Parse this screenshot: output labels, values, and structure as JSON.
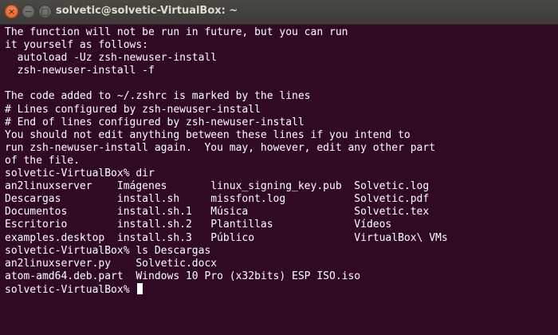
{
  "window": {
    "title": "solvetic@solvetic-VirtualBox: ~",
    "controls": {
      "close": "×",
      "minimize": "−",
      "maximize": "□"
    }
  },
  "colors": {
    "terminal_background": "#300a24",
    "terminal_text": "#ffffff",
    "titlebar": "#3c3b37",
    "close_button": "#e25a1c"
  },
  "terminal": {
    "lines": [
      "The function will not be run in future, but you can run",
      "it yourself as follows:",
      "  autoload -Uz zsh-newuser-install",
      "  zsh-newuser-install -f",
      "",
      "The code added to ~/.zshrc is marked by the lines",
      "# Lines configured by zsh-newuser-install",
      "# End of lines configured by zsh-newuser-install",
      "You should not edit anything between these lines if you intend to",
      "run zsh-newuser-install again.  You may, however, edit any other part",
      "of the file.",
      "solvetic-VirtualBox% dir",
      "an2linuxserver    Imágenes       linux_signing_key.pub  Solvetic.log",
      "Descargas         install.sh     missfont.log           Solvetic.pdf",
      "Documentos        install.sh.1   Música                 Solvetic.tex",
      "Escritorio        install.sh.2   Plantillas             Vídeos",
      "examples.desktop  install.sh.3   Público                VirtualBox\\ VMs",
      "solvetic-VirtualBox% ls Descargas",
      "an2linuxserver.py    Solvetic.docx",
      "atom-amd64.deb.part  Windows 10 Pro (x32bits) ESP ISO.iso"
    ],
    "prompt": "solvetic-VirtualBox% "
  }
}
